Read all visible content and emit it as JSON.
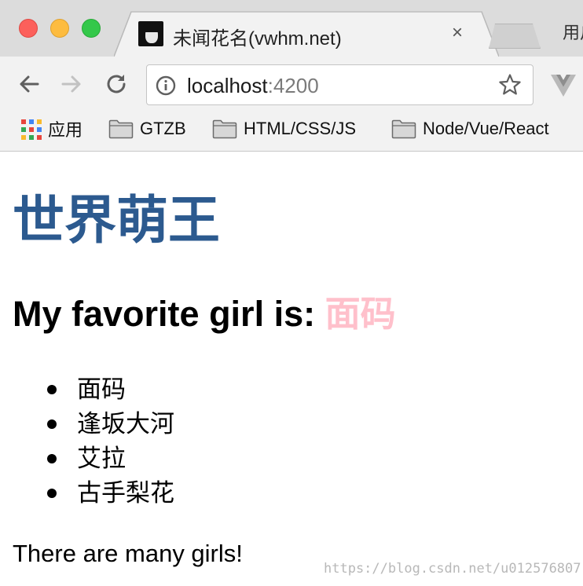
{
  "browser": {
    "tab": {
      "title": "未闻花名(vwhm.net)",
      "close_glyph": "×"
    },
    "profile_text": "用户",
    "address_bar": {
      "host": "localhost",
      "port": ":4200"
    },
    "icons": [
      "back-icon",
      "forward-icon",
      "reload-icon",
      "info-icon",
      "star-icon",
      "vue-devtools-icon",
      "apps-icon",
      "folder-icon"
    ],
    "bookmarks": [
      {
        "label": "应用",
        "icon": "apps-icon"
      },
      {
        "label": "GTZB",
        "icon": "folder-icon"
      },
      {
        "label": "HTML/CSS/JS",
        "icon": "folder-icon"
      },
      {
        "label": "Node/Vue/React",
        "icon": "folder-icon"
      }
    ]
  },
  "page": {
    "heading": "世界萌王",
    "subheading_prefix": "My favorite girl is: ",
    "subheading_highlight": "面码",
    "girls": [
      "面码",
      "逢坂大河",
      "艾拉",
      "古手梨花"
    ],
    "footer_text": "There are many girls!",
    "watermark": "https://blog.csdn.net/u012576807"
  },
  "colors": {
    "heading": "#2c5a8f",
    "highlight": "#ffc0cb",
    "traffic_red": "#fc605b",
    "traffic_yellow": "#fdbc40",
    "traffic_green": "#34c84a"
  }
}
